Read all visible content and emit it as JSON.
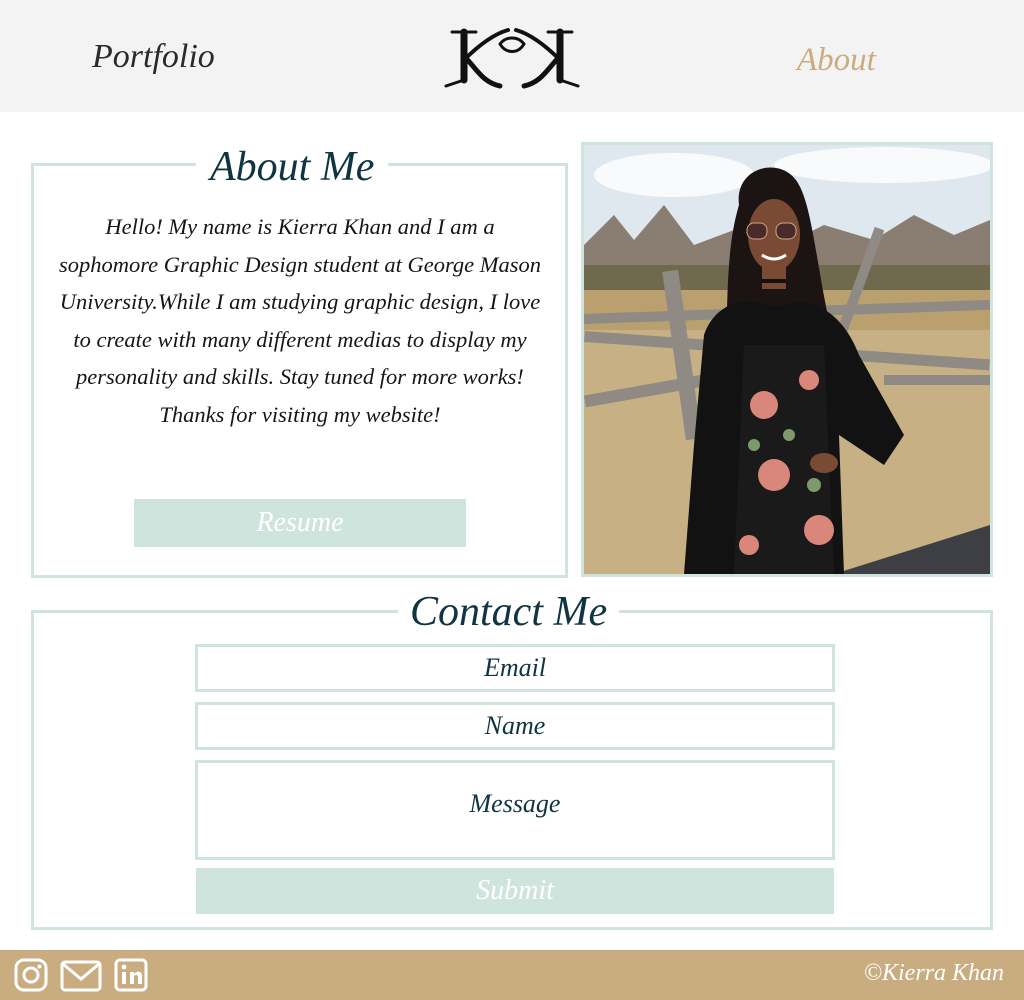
{
  "header": {
    "nav_left": "Portfolio",
    "nav_right": "About",
    "logo_icon": "kk-monogram-logo"
  },
  "about": {
    "title": "About Me",
    "bio": "Hello! My name is Kierra Khan and I am a sophomore Graphic Design student at George Mason University.While I am studying graphic design, I love to create with many different medias to display my personality and skills. Stay tuned for more works! Thanks for visiting my website!",
    "resume_label": "Resume",
    "photo_icon": "profile-photo"
  },
  "contact": {
    "title": "Contact Me",
    "email_placeholder": "Email",
    "name_placeholder": "Name",
    "message_placeholder": "Message",
    "submit_label": "Submit"
  },
  "footer": {
    "icons": [
      "instagram-icon",
      "mail-icon",
      "linkedin-icon"
    ],
    "copyright": "©Kierra Khan"
  },
  "colors": {
    "header_bg": "#f4f3f3",
    "accent_mint": "#cfe4dd",
    "accent_tan": "#c9ac7f",
    "heading_teal": "#0f3540"
  }
}
